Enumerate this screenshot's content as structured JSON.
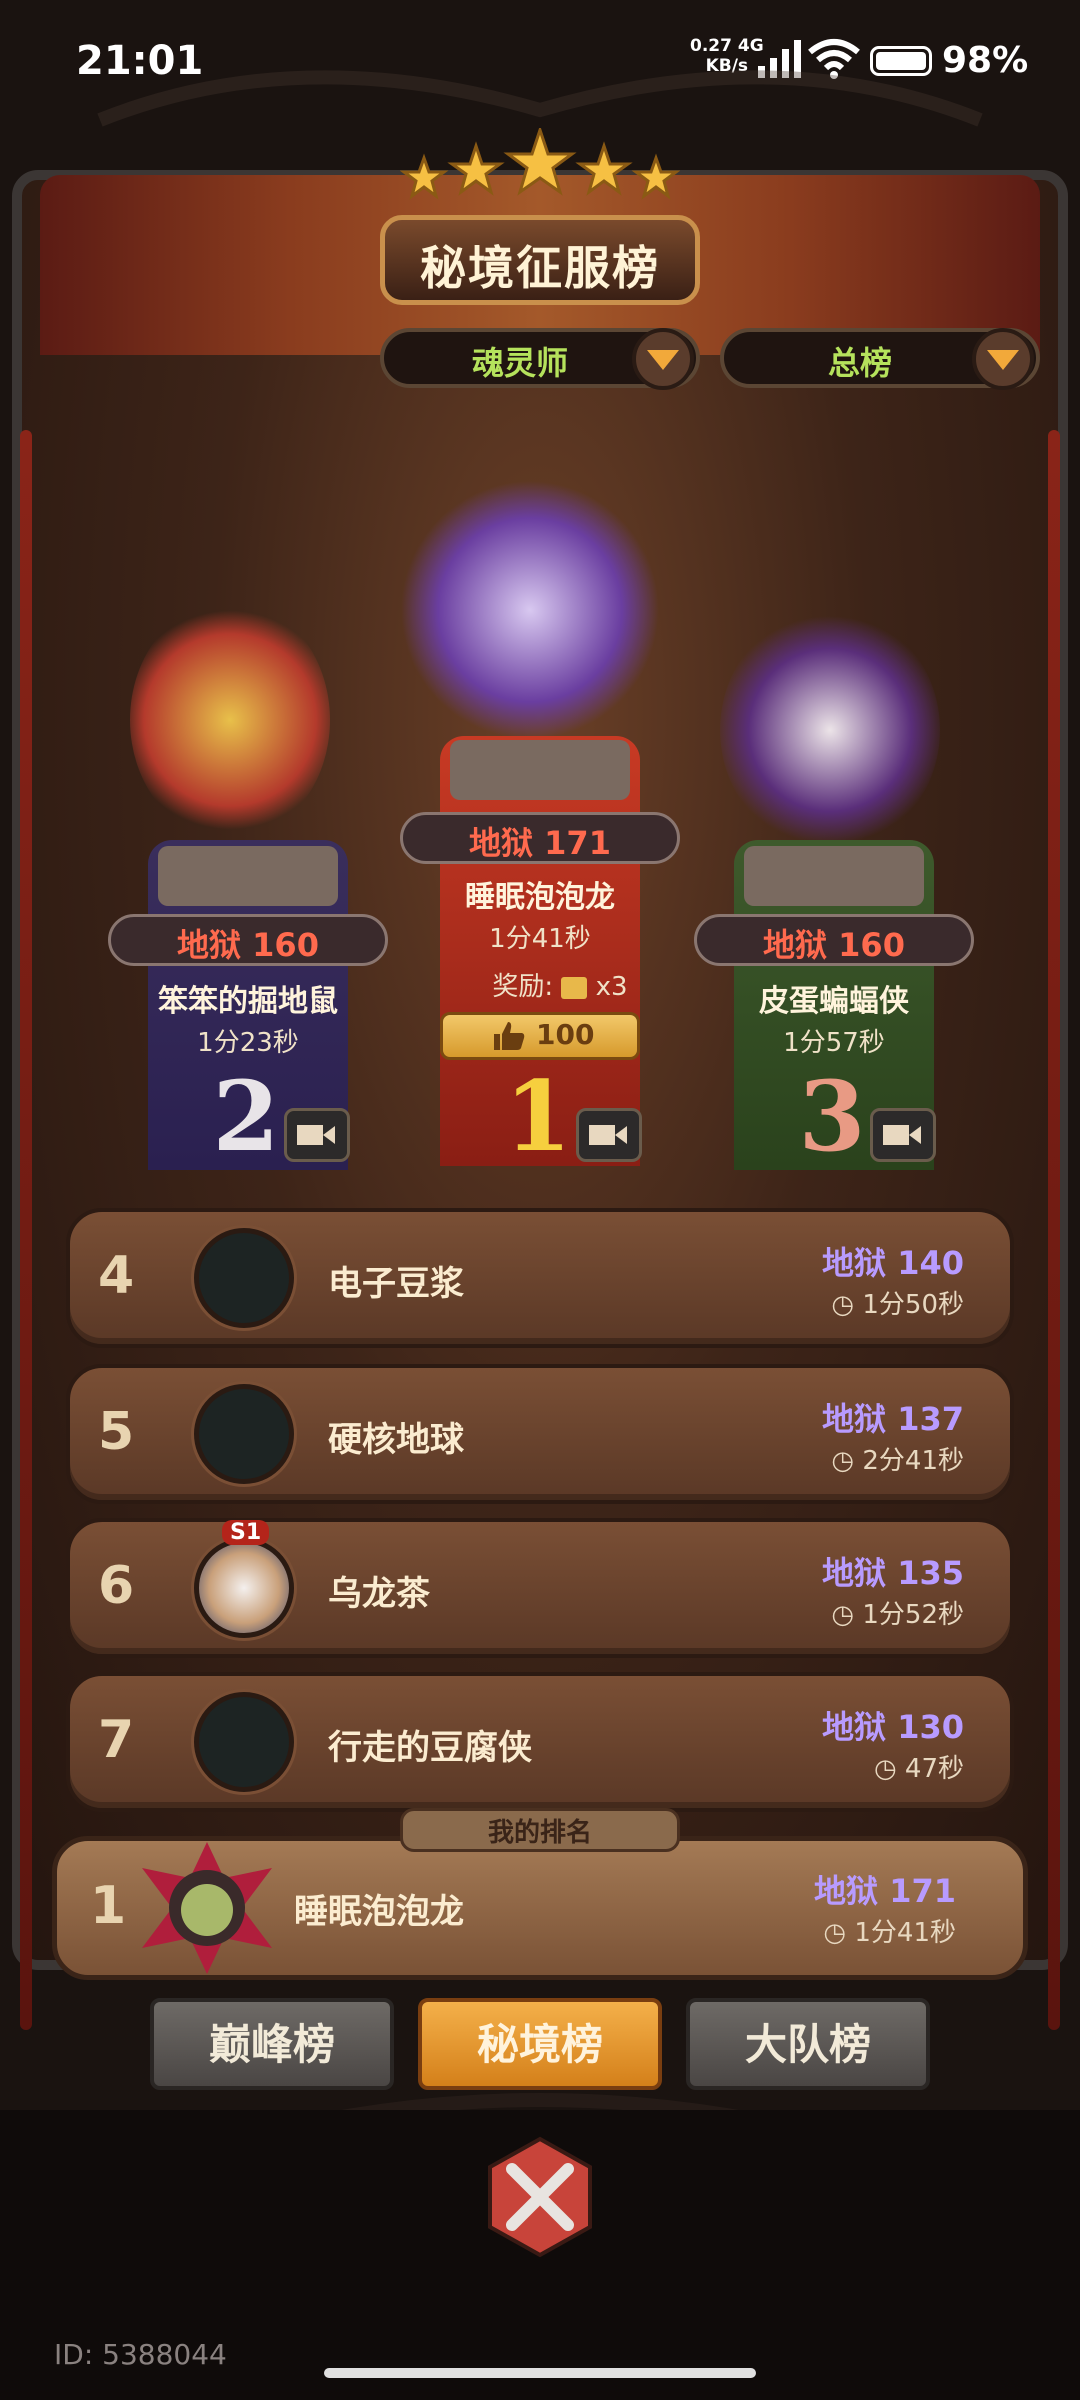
{
  "status_bar": {
    "time": "21:01",
    "net_speed": "0.27",
    "net_unit": "KB/s",
    "net_type": "4G",
    "battery": "98%"
  },
  "header": {
    "title": "秘境征服榜",
    "stars": 5,
    "class_filter": "魂灵师",
    "board_filter": "总榜"
  },
  "podium": [
    {
      "rank": "2",
      "level": "地狱 160",
      "name": "笨笨的掘地鼠",
      "time": "1分23秒"
    },
    {
      "rank": "1",
      "level": "地狱 171",
      "name": "睡眠泡泡龙",
      "time": "1分41秒",
      "reward_label": "奖励:",
      "reward_count": "x3",
      "likes": "100"
    },
    {
      "rank": "3",
      "level": "地狱 160",
      "name": "皮蛋蝙蝠侠",
      "time": "1分57秒"
    }
  ],
  "rankings": [
    {
      "rank": "4",
      "name": "电子豆浆",
      "score": "地狱 140",
      "time": "1分50秒"
    },
    {
      "rank": "5",
      "name": "硬核地球",
      "score": "地狱 137",
      "time": "2分41秒"
    },
    {
      "rank": "6",
      "name": "乌龙茶",
      "score": "地狱 135",
      "time": "1分52秒",
      "badge": "S1"
    },
    {
      "rank": "7",
      "name": "行走的豆腐侠",
      "score": "地狱 130",
      "time": "47秒"
    }
  ],
  "my_rank": {
    "label": "我的排名",
    "rank": "1",
    "name": "睡眠泡泡龙",
    "score": "地狱 171",
    "time": "1分41秒"
  },
  "tabs": [
    {
      "label": "巅峰榜",
      "active": false
    },
    {
      "label": "秘境榜",
      "active": true
    },
    {
      "label": "大队榜",
      "active": false
    }
  ],
  "footer": {
    "id_text": "ID: 5388044"
  },
  "colors": {
    "accent": "#f2a93a",
    "score": "#b89bff",
    "hell": "#ff6a4e",
    "filter": "#b5e25c"
  }
}
